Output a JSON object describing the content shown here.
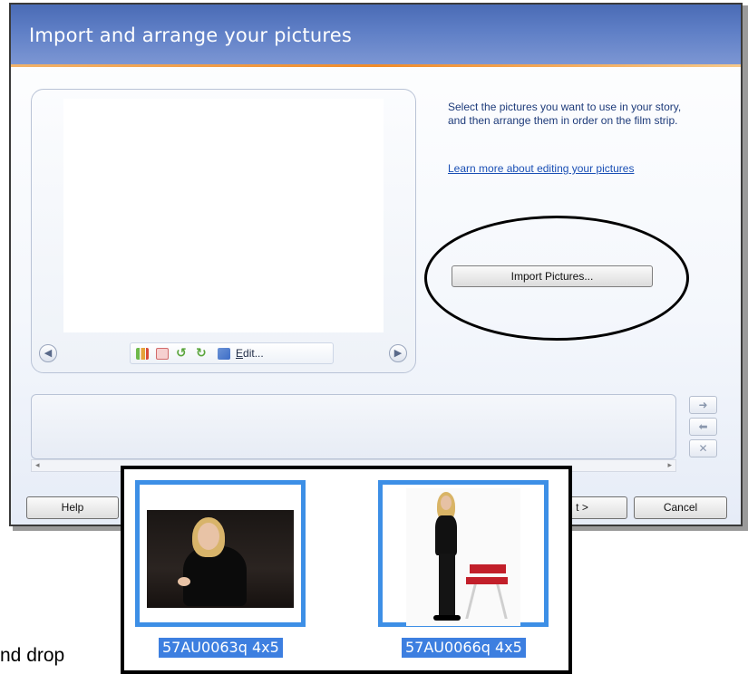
{
  "window": {
    "title": "Import and arrange your pictures"
  },
  "info": {
    "description": "Select the pictures you want to use in your story, and then arrange them in order on the film strip.",
    "learn_more": "Learn more about editing your pictures"
  },
  "preview": {
    "edit_label": "Edit...",
    "prev_icon": "left-arrow-circle",
    "next_icon": "right-arrow-circle"
  },
  "buttons": {
    "import": "Import Pictures...",
    "help": "Help",
    "next_partial": "t >",
    "cancel": "Cancel"
  },
  "filmstrip": {
    "move_right_glyph": "➜",
    "move_left_glyph": "⬅",
    "remove_glyph": "✕",
    "scroll_left_glyph": "◂",
    "scroll_right_glyph": "▸"
  },
  "thumbnails": [
    {
      "label": "57AU0063q 4x5"
    },
    {
      "label": "57AU0066q 4x5"
    }
  ],
  "background_text": "nd drop",
  "colors": {
    "title_bar": "#5f7fc6",
    "accent_orange": "#f08b2a",
    "selection_blue": "#3d8fe6",
    "label_highlight": "#3d7fe0",
    "link": "#1a4fb5"
  }
}
